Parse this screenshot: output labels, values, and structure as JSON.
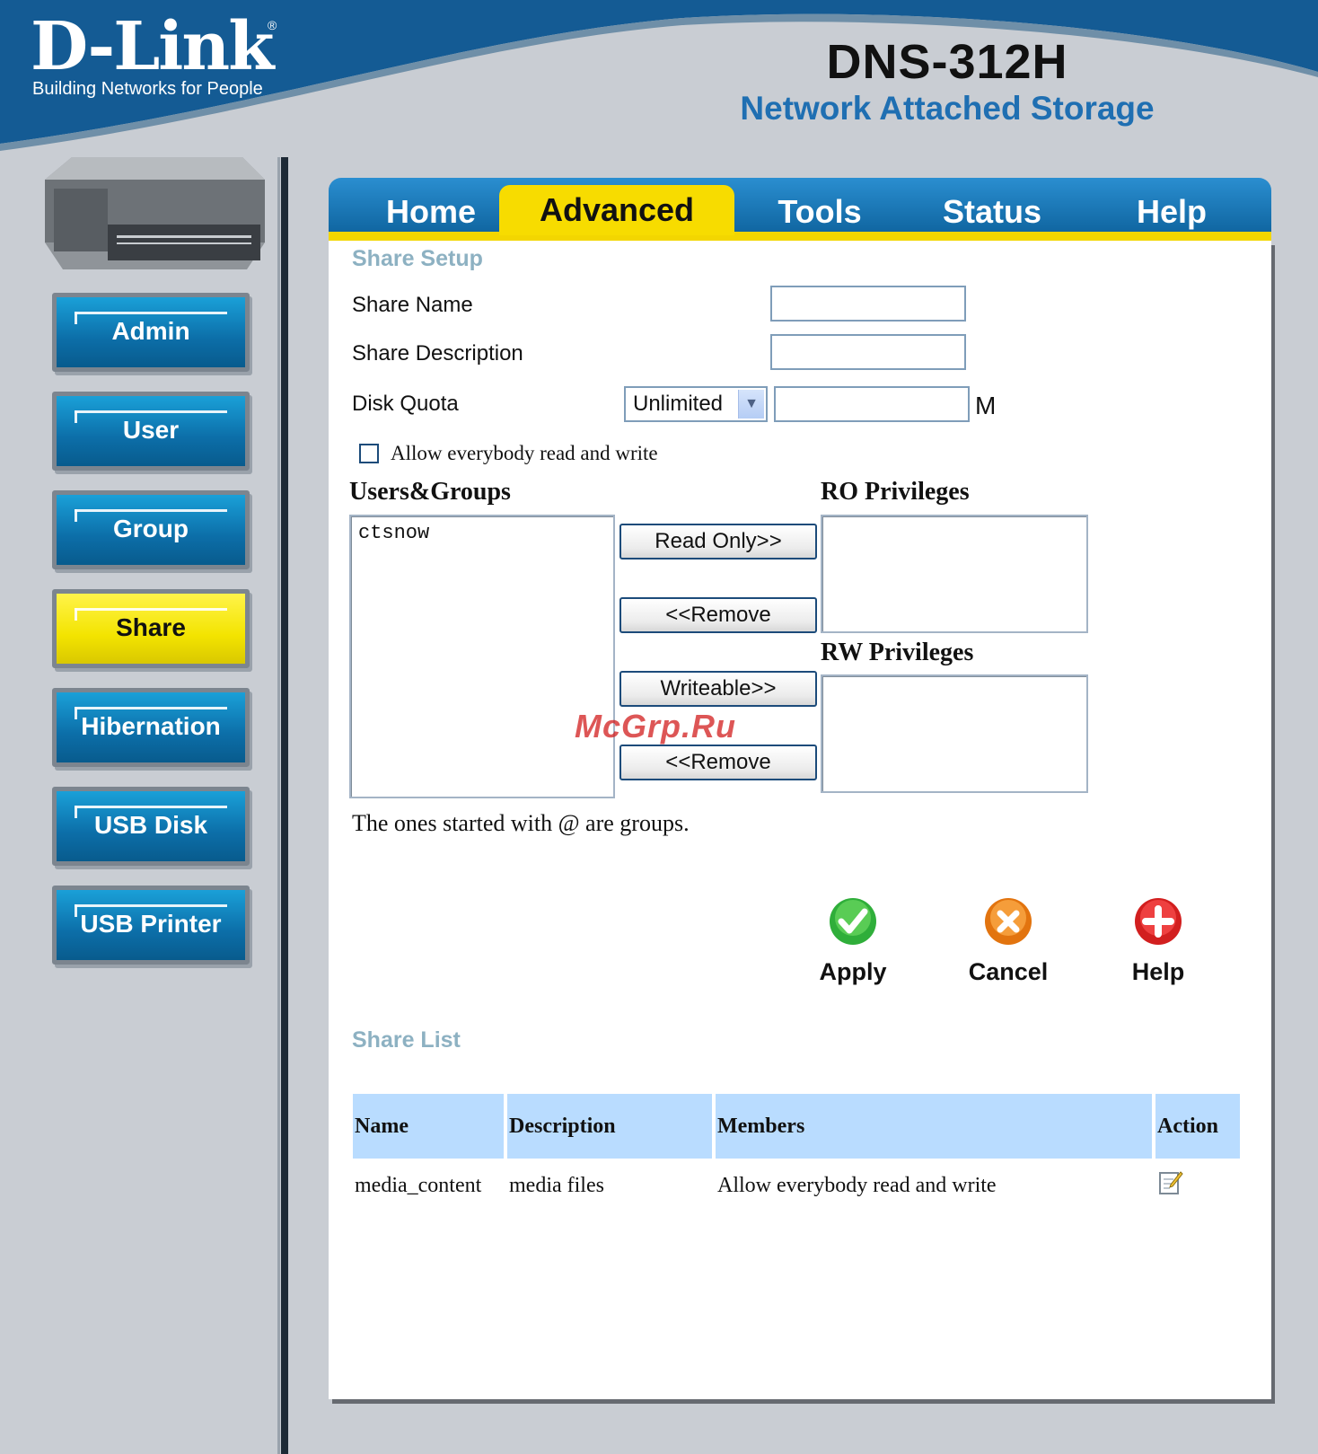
{
  "header": {
    "logo": "D-Link",
    "tagline": "Building Networks for People",
    "model": "DNS-312H",
    "product": "Network Attached Storage"
  },
  "tabs": [
    {
      "label": "Home",
      "active": false
    },
    {
      "label": "Advanced",
      "active": true
    },
    {
      "label": "Tools",
      "active": false
    },
    {
      "label": "Status",
      "active": false
    },
    {
      "label": "Help",
      "active": false
    }
  ],
  "sidebar": {
    "items": [
      {
        "label": "Admin",
        "active": false
      },
      {
        "label": "User",
        "active": false
      },
      {
        "label": "Group",
        "active": false
      },
      {
        "label": "Share",
        "active": true
      },
      {
        "label": "Hibernation",
        "active": false
      },
      {
        "label": "USB Disk",
        "active": false
      },
      {
        "label": "USB Printer",
        "active": false
      }
    ]
  },
  "share_setup": {
    "title": "Share Setup",
    "share_name_label": "Share Name",
    "share_name_value": "",
    "share_desc_label": "Share Description",
    "share_desc_value": "",
    "disk_quota_label": "Disk Quota",
    "disk_quota_option": "Unlimited",
    "disk_quota_value": "",
    "disk_quota_unit": "M",
    "allow_all_label": "Allow everybody read and write",
    "allow_all_checked": false,
    "users_groups_label": "Users&Groups",
    "users_groups": [
      "ctsnow"
    ],
    "ro_label": "RO Privileges",
    "rw_label": "RW Privileges",
    "read_only_button": "Read Only>>",
    "remove_ro_button": "<<Remove",
    "writeable_button": "Writeable>>",
    "remove_rw_button": "<<Remove",
    "groups_note": "The ones started with @ are groups."
  },
  "actions": {
    "apply": "Apply",
    "cancel": "Cancel",
    "help": "Help"
  },
  "share_list": {
    "title": "Share List",
    "columns": [
      "Name",
      "Description",
      "Members",
      "Action"
    ],
    "rows": [
      {
        "name": "media_content",
        "description": "media files",
        "members": "Allow everybody read and write"
      }
    ]
  },
  "watermark": "McGrp.Ru",
  "colors": {
    "brand_blue": "#0b5e98",
    "active_yellow": "#f7dc00",
    "section_title": "#8db1c2",
    "table_header": "#b9dcff",
    "product_text": "#1f6fb2"
  }
}
